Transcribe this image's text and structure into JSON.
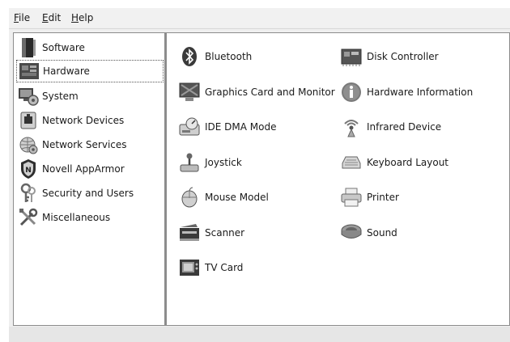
{
  "menubar": {
    "file": {
      "pre": "",
      "u": "F",
      "post": "ile"
    },
    "edit": {
      "pre": "",
      "u": "E",
      "post": "dit"
    },
    "help": {
      "pre": "",
      "u": "H",
      "post": "elp"
    }
  },
  "sidebar": {
    "selected": "Hardware",
    "items": [
      {
        "label": "Software",
        "icon": "software-icon"
      },
      {
        "label": "Hardware",
        "icon": "hardware-icon"
      },
      {
        "label": "System",
        "icon": "system-icon"
      },
      {
        "label": "Network Devices",
        "icon": "network-devices-icon"
      },
      {
        "label": "Network Services",
        "icon": "network-services-icon"
      },
      {
        "label": "Novell AppArmor",
        "icon": "apparmor-shield-icon"
      },
      {
        "label": "Security and Users",
        "icon": "security-keys-icon"
      },
      {
        "label": "Miscellaneous",
        "icon": "tools-icon"
      }
    ]
  },
  "modules": [
    {
      "label": "Bluetooth",
      "icon": "bluetooth-icon"
    },
    {
      "label": "Disk Controller",
      "icon": "disk-controller-icon"
    },
    {
      "label": "Graphics Card and Monitor",
      "icon": "monitor-icon"
    },
    {
      "label": "Hardware Information",
      "icon": "info-icon"
    },
    {
      "label": "IDE DMA Mode",
      "icon": "ide-dma-icon"
    },
    {
      "label": "Infrared Device",
      "icon": "infrared-icon"
    },
    {
      "label": "Joystick",
      "icon": "joystick-icon"
    },
    {
      "label": "Keyboard Layout",
      "icon": "keyboard-icon"
    },
    {
      "label": "Mouse Model",
      "icon": "mouse-icon"
    },
    {
      "label": "Printer",
      "icon": "printer-icon"
    },
    {
      "label": "Scanner",
      "icon": "scanner-icon"
    },
    {
      "label": "Sound",
      "icon": "sound-icon"
    },
    {
      "label": "TV Card",
      "icon": "tv-card-icon"
    }
  ]
}
